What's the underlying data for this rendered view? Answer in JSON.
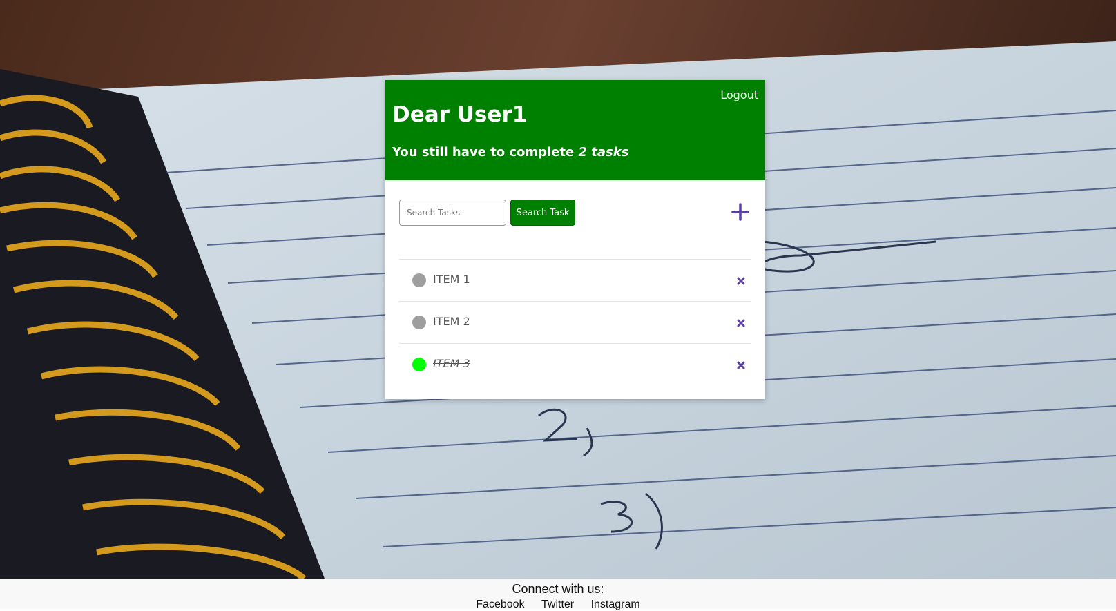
{
  "header": {
    "logout_label": "Logout",
    "greeting": "Dear User1",
    "subtitle_prefix": "You still have to complete",
    "subtitle_emphasis": "2 tasks"
  },
  "search": {
    "placeholder": "Search Tasks",
    "value": "",
    "button_label": "Search Task"
  },
  "icons": {
    "add": "plus-icon",
    "delete": "close-icon",
    "status": "circle-icon"
  },
  "colors": {
    "header_bg": "#008000",
    "accent": "#5c3fa3",
    "pending": "#9e9e9e",
    "done": "#00ff00"
  },
  "tasks": [
    {
      "label": "ITEM 1",
      "status": "pending"
    },
    {
      "label": "ITEM 2",
      "status": "pending"
    },
    {
      "label": "ITEM 3",
      "status": "done"
    }
  ],
  "footer": {
    "title": "Connect with us:",
    "links": [
      "Facebook",
      "Twitter",
      "Instagram"
    ]
  }
}
